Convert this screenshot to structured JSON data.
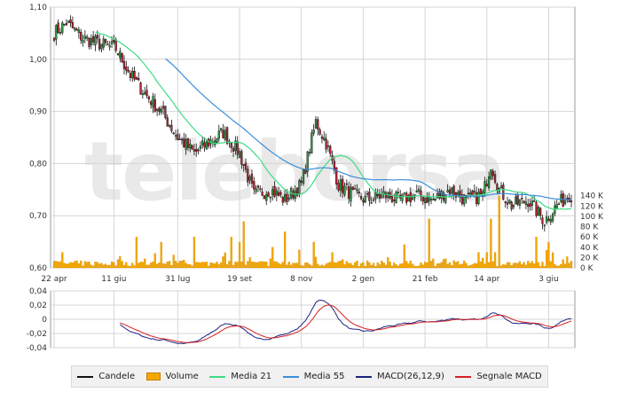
{
  "watermark": "teleborsa",
  "colors": {
    "up": "#2e9a3e",
    "down": "#b22234",
    "volume": "#f5a800",
    "ma21": "#3ddc84",
    "ma55": "#3a8fd9",
    "macd": "#1a237e",
    "signal": "#d62020",
    "grid": "#d4d4d4"
  },
  "chart_data": [
    {
      "type": "candlestick",
      "panel": "price",
      "x_ticks": [
        "22 apr",
        "11 giu",
        "31 lug",
        "19 set",
        "8 nov",
        "2 gen",
        "21 feb",
        "14 apr",
        "3 giu"
      ],
      "y_ticks": [
        "0,60",
        "0,70",
        "0,80",
        "0,90",
        "1,00",
        "1,10"
      ],
      "ylim": [
        0.6,
        1.1
      ],
      "volume_ticks": [
        "0 K",
        "20 K",
        "40 K",
        "60 K",
        "80 K",
        "100 K",
        "120 K",
        "140 K"
      ],
      "volume_lim": [
        0,
        155000
      ],
      "close_anchors": [
        [
          0,
          1.05
        ],
        [
          6,
          1.07
        ],
        [
          14,
          1.04
        ],
        [
          22,
          1.03
        ],
        [
          30,
          1.02
        ],
        [
          37,
          0.97
        ],
        [
          45,
          0.93
        ],
        [
          52,
          0.9
        ],
        [
          60,
          0.85
        ],
        [
          68,
          0.82
        ],
        [
          75,
          0.84
        ],
        [
          82,
          0.86
        ],
        [
          90,
          0.82
        ],
        [
          97,
          0.74
        ],
        [
          105,
          0.75
        ],
        [
          112,
          0.73
        ],
        [
          120,
          0.76
        ],
        [
          127,
          0.88
        ],
        [
          132,
          0.84
        ],
        [
          138,
          0.76
        ],
        [
          145,
          0.74
        ],
        [
          152,
          0.73
        ],
        [
          160,
          0.74
        ],
        [
          168,
          0.73
        ],
        [
          176,
          0.74
        ],
        [
          184,
          0.73
        ],
        [
          192,
          0.75
        ],
        [
          200,
          0.73
        ],
        [
          208,
          0.74
        ],
        [
          212,
          0.8
        ],
        [
          216,
          0.75
        ],
        [
          222,
          0.72
        ],
        [
          230,
          0.73
        ],
        [
          238,
          0.69
        ],
        [
          244,
          0.72
        ],
        [
          250,
          0.74
        ]
      ],
      "volume_spikes": [
        [
          4,
          30000
        ],
        [
          40,
          60000
        ],
        [
          52,
          50000
        ],
        [
          58,
          25000
        ],
        [
          68,
          60000
        ],
        [
          86,
          60000
        ],
        [
          90,
          50000
        ],
        [
          92,
          90000
        ],
        [
          95,
          20000
        ],
        [
          106,
          40000
        ],
        [
          112,
          70000
        ],
        [
          119,
          35000
        ],
        [
          126,
          50000
        ],
        [
          135,
          30000
        ],
        [
          170,
          45000
        ],
        [
          182,
          95000
        ],
        [
          206,
          30000
        ],
        [
          210,
          30000
        ],
        [
          212,
          95000
        ],
        [
          214,
          30000
        ],
        [
          216,
          140000
        ],
        [
          234,
          60000
        ],
        [
          240,
          50000
        ]
      ],
      "volume_base": 7000,
      "ma_series": [
        {
          "name": "Media 21",
          "period": 21
        },
        {
          "name": "Media 55",
          "period": 55
        }
      ]
    },
    {
      "type": "line",
      "panel": "macd",
      "y_ticks": [
        "0,04",
        "0,02",
        "0",
        "-0,02",
        "-0,04"
      ],
      "ylim": [
        -0.04,
        0.04
      ],
      "series": [
        {
          "name": "MACD(26,12,9)"
        },
        {
          "name": "Segnale MACD"
        }
      ]
    }
  ],
  "legend": {
    "items": [
      {
        "label": "Candele",
        "swatch": "#111111"
      },
      {
        "label": "Volume",
        "swatch": "#f5a800"
      },
      {
        "label": "Media 21",
        "swatch": "#3ddc84"
      },
      {
        "label": "Media 55",
        "swatch": "#3a8fd9"
      },
      {
        "label": "MACD(26,12,9)",
        "swatch": "#1a237e"
      },
      {
        "label": "Segnale MACD",
        "swatch": "#d62020"
      }
    ]
  }
}
